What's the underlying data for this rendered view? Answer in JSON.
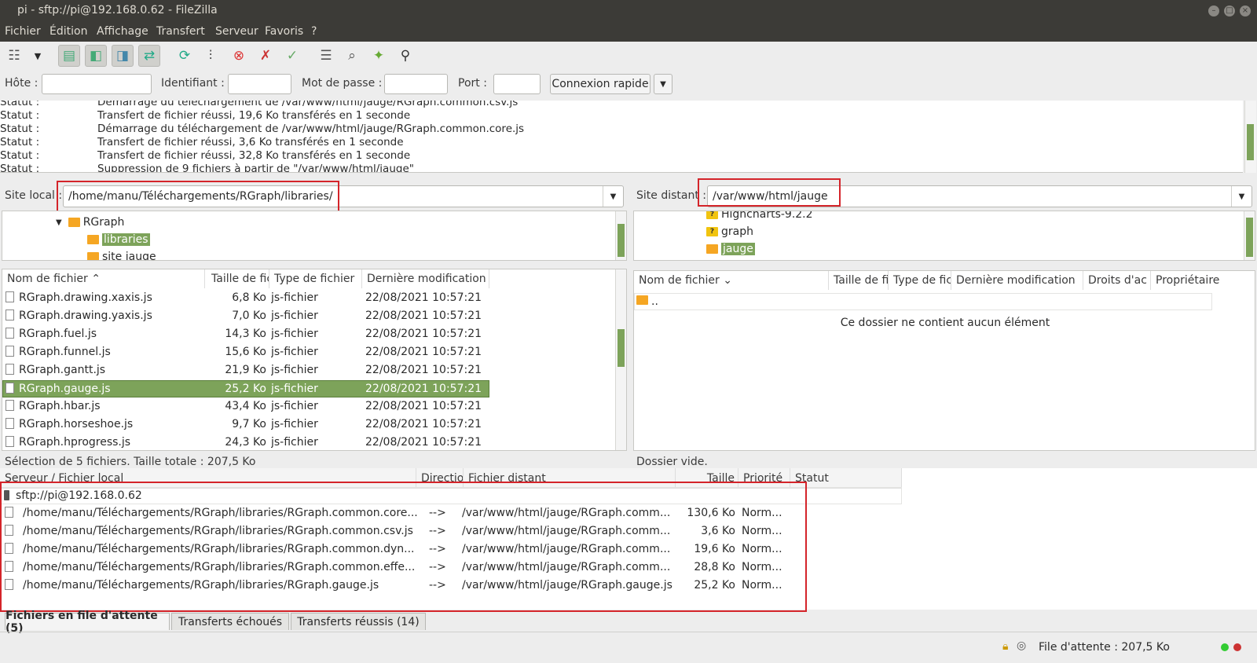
{
  "window": {
    "title": "pi - sftp://pi@192.168.0.62 - FileZilla"
  },
  "menu": [
    "Fichier",
    "Édition",
    "Affichage",
    "Transfert",
    "Serveur",
    "Favoris",
    "?"
  ],
  "quickconnect": {
    "host_label": "Hôte :",
    "user_label": "Identifiant :",
    "pass_label": "Mot de passe :",
    "port_label": "Port :",
    "host_value": "",
    "user_value": "",
    "pass_value": "",
    "port_value": "",
    "connect_label": "Connexion rapide"
  },
  "log": [
    {
      "k": "Statut :",
      "v": "Démarrage du téléchargement de /var/www/html/jauge/RGraph.common.csv.js"
    },
    {
      "k": "Statut :",
      "v": "Transfert de fichier réussi, 19,6 Ko transférés en 1 seconde"
    },
    {
      "k": "Statut :",
      "v": "Démarrage du téléchargement de /var/www/html/jauge/RGraph.common.core.js"
    },
    {
      "k": "Statut :",
      "v": "Transfert de fichier réussi, 3,6 Ko transférés en 1 seconde"
    },
    {
      "k": "Statut :",
      "v": "Transfert de fichier réussi, 32,8 Ko transférés en 1 seconde"
    },
    {
      "k": "Statut :",
      "v": "Suppression de 9 fichiers à partir de \"/var/www/html/jauge\""
    }
  ],
  "local": {
    "label": "Site local :",
    "path": "/home/manu/Téléchargements/RGraph/libraries/",
    "tree": [
      "RGraph",
      "libraries",
      "site jauge"
    ],
    "headers": [
      "Nom de fichier",
      "Taille de fic",
      "Type de fichier",
      "Dernière modification"
    ],
    "files": [
      {
        "name": "RGraph.drawing.xaxis.js",
        "size": "6,8 Ko",
        "type": "js-fichier",
        "date": "22/08/2021 10:57:21"
      },
      {
        "name": "RGraph.drawing.yaxis.js",
        "size": "7,0 Ko",
        "type": "js-fichier",
        "date": "22/08/2021 10:57:21"
      },
      {
        "name": "RGraph.fuel.js",
        "size": "14,3 Ko",
        "type": "js-fichier",
        "date": "22/08/2021 10:57:21"
      },
      {
        "name": "RGraph.funnel.js",
        "size": "15,6 Ko",
        "type": "js-fichier",
        "date": "22/08/2021 10:57:21"
      },
      {
        "name": "RGraph.gantt.js",
        "size": "21,9 Ko",
        "type": "js-fichier",
        "date": "22/08/2021 10:57:21"
      },
      {
        "name": "RGraph.gauge.js",
        "size": "25,2 Ko",
        "type": "js-fichier",
        "date": "22/08/2021 10:57:21"
      },
      {
        "name": "RGraph.hbar.js",
        "size": "43,4 Ko",
        "type": "js-fichier",
        "date": "22/08/2021 10:57:21"
      },
      {
        "name": "RGraph.horseshoe.js",
        "size": "9,7 Ko",
        "type": "js-fichier",
        "date": "22/08/2021 10:57:21"
      },
      {
        "name": "RGraph.hprogress.js",
        "size": "24,3 Ko",
        "type": "js-fichier",
        "date": "22/08/2021 10:57:21"
      }
    ],
    "status": "Sélection de 5 fichiers. Taille totale : 207,5 Ko"
  },
  "remote": {
    "label": "Site distant :",
    "path": "/var/www/html/jauge",
    "tree": [
      "Highcharts-9.2.2",
      "graph",
      "jauge"
    ],
    "headers": [
      "Nom de fichier",
      "Taille de fi",
      "Type de fich",
      "Dernière modification",
      "Droits d'ac",
      "Propriétaire"
    ],
    "parent": "..",
    "empty_msg": "Ce dossier ne contient aucun élément",
    "status": "Dossier vide."
  },
  "queue": {
    "headers": [
      "Serveur / Fichier local",
      "Directio",
      "Fichier distant",
      "Taille",
      "Priorité",
      "Statut"
    ],
    "server": "sftp://pi@192.168.0.62",
    "items": [
      {
        "local": "/home/manu/Téléchargements/RGraph/libraries/RGraph.common.core...",
        "dir": "-->",
        "remote": "/var/www/html/jauge/RGraph.comm...",
        "size": "130,6 Ko",
        "prio": "Norm..."
      },
      {
        "local": "/home/manu/Téléchargements/RGraph/libraries/RGraph.common.csv.js",
        "dir": "-->",
        "remote": "/var/www/html/jauge/RGraph.comm...",
        "size": "3,6 Ko",
        "prio": "Norm..."
      },
      {
        "local": "/home/manu/Téléchargements/RGraph/libraries/RGraph.common.dyn...",
        "dir": "-->",
        "remote": "/var/www/html/jauge/RGraph.comm...",
        "size": "19,6 Ko",
        "prio": "Norm..."
      },
      {
        "local": "/home/manu/Téléchargements/RGraph/libraries/RGraph.common.effe...",
        "dir": "-->",
        "remote": "/var/www/html/jauge/RGraph.comm...",
        "size": "28,8 Ko",
        "prio": "Norm..."
      },
      {
        "local": "/home/manu/Téléchargements/RGraph/libraries/RGraph.gauge.js",
        "dir": "-->",
        "remote": "/var/www/html/jauge/RGraph.gauge.js",
        "size": "25,2 Ko",
        "prio": "Norm..."
      }
    ]
  },
  "tabs": [
    "Fichiers en file d'attente (5)",
    "Transferts échoués",
    "Transferts réussis (14)"
  ],
  "statusbar": {
    "queue": "File d'attente : 207,5 Ko"
  },
  "colors": {
    "accent": "#7da35a",
    "highlight": "#d4242a",
    "titlebar": "#3c3b37"
  }
}
